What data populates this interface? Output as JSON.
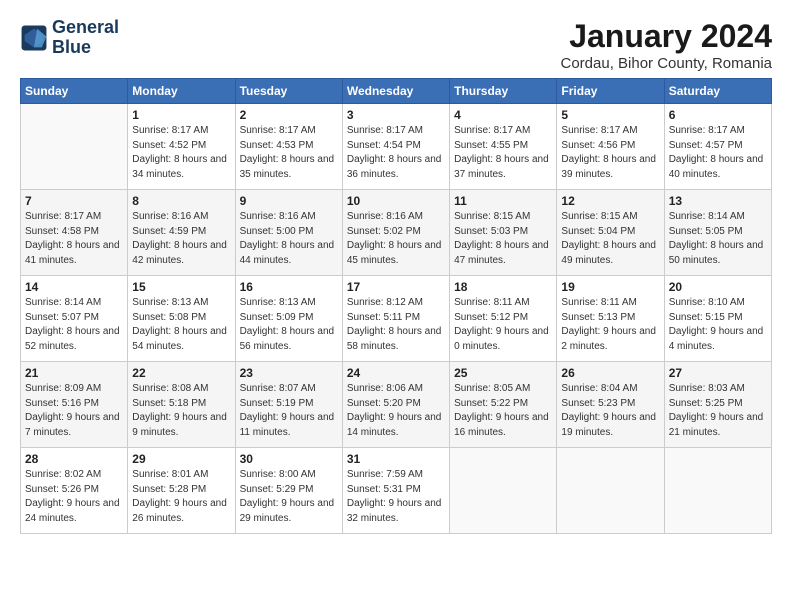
{
  "logo": {
    "line1": "General",
    "line2": "Blue"
  },
  "title": "January 2024",
  "subtitle": "Cordau, Bihor County, Romania",
  "days_header": [
    "Sunday",
    "Monday",
    "Tuesday",
    "Wednesday",
    "Thursday",
    "Friday",
    "Saturday"
  ],
  "weeks": [
    [
      {
        "day": "",
        "sunrise": "",
        "sunset": "",
        "daylight": ""
      },
      {
        "day": "1",
        "sunrise": "Sunrise: 8:17 AM",
        "sunset": "Sunset: 4:52 PM",
        "daylight": "Daylight: 8 hours and 34 minutes."
      },
      {
        "day": "2",
        "sunrise": "Sunrise: 8:17 AM",
        "sunset": "Sunset: 4:53 PM",
        "daylight": "Daylight: 8 hours and 35 minutes."
      },
      {
        "day": "3",
        "sunrise": "Sunrise: 8:17 AM",
        "sunset": "Sunset: 4:54 PM",
        "daylight": "Daylight: 8 hours and 36 minutes."
      },
      {
        "day": "4",
        "sunrise": "Sunrise: 8:17 AM",
        "sunset": "Sunset: 4:55 PM",
        "daylight": "Daylight: 8 hours and 37 minutes."
      },
      {
        "day": "5",
        "sunrise": "Sunrise: 8:17 AM",
        "sunset": "Sunset: 4:56 PM",
        "daylight": "Daylight: 8 hours and 39 minutes."
      },
      {
        "day": "6",
        "sunrise": "Sunrise: 8:17 AM",
        "sunset": "Sunset: 4:57 PM",
        "daylight": "Daylight: 8 hours and 40 minutes."
      }
    ],
    [
      {
        "day": "7",
        "sunrise": "Sunrise: 8:17 AM",
        "sunset": "Sunset: 4:58 PM",
        "daylight": "Daylight: 8 hours and 41 minutes."
      },
      {
        "day": "8",
        "sunrise": "Sunrise: 8:16 AM",
        "sunset": "Sunset: 4:59 PM",
        "daylight": "Daylight: 8 hours and 42 minutes."
      },
      {
        "day": "9",
        "sunrise": "Sunrise: 8:16 AM",
        "sunset": "Sunset: 5:00 PM",
        "daylight": "Daylight: 8 hours and 44 minutes."
      },
      {
        "day": "10",
        "sunrise": "Sunrise: 8:16 AM",
        "sunset": "Sunset: 5:02 PM",
        "daylight": "Daylight: 8 hours and 45 minutes."
      },
      {
        "day": "11",
        "sunrise": "Sunrise: 8:15 AM",
        "sunset": "Sunset: 5:03 PM",
        "daylight": "Daylight: 8 hours and 47 minutes."
      },
      {
        "day": "12",
        "sunrise": "Sunrise: 8:15 AM",
        "sunset": "Sunset: 5:04 PM",
        "daylight": "Daylight: 8 hours and 49 minutes."
      },
      {
        "day": "13",
        "sunrise": "Sunrise: 8:14 AM",
        "sunset": "Sunset: 5:05 PM",
        "daylight": "Daylight: 8 hours and 50 minutes."
      }
    ],
    [
      {
        "day": "14",
        "sunrise": "Sunrise: 8:14 AM",
        "sunset": "Sunset: 5:07 PM",
        "daylight": "Daylight: 8 hours and 52 minutes."
      },
      {
        "day": "15",
        "sunrise": "Sunrise: 8:13 AM",
        "sunset": "Sunset: 5:08 PM",
        "daylight": "Daylight: 8 hours and 54 minutes."
      },
      {
        "day": "16",
        "sunrise": "Sunrise: 8:13 AM",
        "sunset": "Sunset: 5:09 PM",
        "daylight": "Daylight: 8 hours and 56 minutes."
      },
      {
        "day": "17",
        "sunrise": "Sunrise: 8:12 AM",
        "sunset": "Sunset: 5:11 PM",
        "daylight": "Daylight: 8 hours and 58 minutes."
      },
      {
        "day": "18",
        "sunrise": "Sunrise: 8:11 AM",
        "sunset": "Sunset: 5:12 PM",
        "daylight": "Daylight: 9 hours and 0 minutes."
      },
      {
        "day": "19",
        "sunrise": "Sunrise: 8:11 AM",
        "sunset": "Sunset: 5:13 PM",
        "daylight": "Daylight: 9 hours and 2 minutes."
      },
      {
        "day": "20",
        "sunrise": "Sunrise: 8:10 AM",
        "sunset": "Sunset: 5:15 PM",
        "daylight": "Daylight: 9 hours and 4 minutes."
      }
    ],
    [
      {
        "day": "21",
        "sunrise": "Sunrise: 8:09 AM",
        "sunset": "Sunset: 5:16 PM",
        "daylight": "Daylight: 9 hours and 7 minutes."
      },
      {
        "day": "22",
        "sunrise": "Sunrise: 8:08 AM",
        "sunset": "Sunset: 5:18 PM",
        "daylight": "Daylight: 9 hours and 9 minutes."
      },
      {
        "day": "23",
        "sunrise": "Sunrise: 8:07 AM",
        "sunset": "Sunset: 5:19 PM",
        "daylight": "Daylight: 9 hours and 11 minutes."
      },
      {
        "day": "24",
        "sunrise": "Sunrise: 8:06 AM",
        "sunset": "Sunset: 5:20 PM",
        "daylight": "Daylight: 9 hours and 14 minutes."
      },
      {
        "day": "25",
        "sunrise": "Sunrise: 8:05 AM",
        "sunset": "Sunset: 5:22 PM",
        "daylight": "Daylight: 9 hours and 16 minutes."
      },
      {
        "day": "26",
        "sunrise": "Sunrise: 8:04 AM",
        "sunset": "Sunset: 5:23 PM",
        "daylight": "Daylight: 9 hours and 19 minutes."
      },
      {
        "day": "27",
        "sunrise": "Sunrise: 8:03 AM",
        "sunset": "Sunset: 5:25 PM",
        "daylight": "Daylight: 9 hours and 21 minutes."
      }
    ],
    [
      {
        "day": "28",
        "sunrise": "Sunrise: 8:02 AM",
        "sunset": "Sunset: 5:26 PM",
        "daylight": "Daylight: 9 hours and 24 minutes."
      },
      {
        "day": "29",
        "sunrise": "Sunrise: 8:01 AM",
        "sunset": "Sunset: 5:28 PM",
        "daylight": "Daylight: 9 hours and 26 minutes."
      },
      {
        "day": "30",
        "sunrise": "Sunrise: 8:00 AM",
        "sunset": "Sunset: 5:29 PM",
        "daylight": "Daylight: 9 hours and 29 minutes."
      },
      {
        "day": "31",
        "sunrise": "Sunrise: 7:59 AM",
        "sunset": "Sunset: 5:31 PM",
        "daylight": "Daylight: 9 hours and 32 minutes."
      },
      {
        "day": "",
        "sunrise": "",
        "sunset": "",
        "daylight": ""
      },
      {
        "day": "",
        "sunrise": "",
        "sunset": "",
        "daylight": ""
      },
      {
        "day": "",
        "sunrise": "",
        "sunset": "",
        "daylight": ""
      }
    ]
  ]
}
